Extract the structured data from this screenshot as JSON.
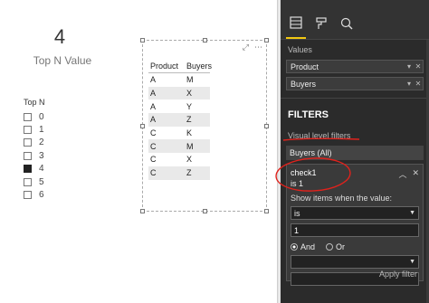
{
  "card": {
    "value": "4",
    "label": "Top N Value"
  },
  "slicer": {
    "title": "Top N",
    "items": [
      {
        "label": "0",
        "checked": false
      },
      {
        "label": "1",
        "checked": false
      },
      {
        "label": "2",
        "checked": false
      },
      {
        "label": "3",
        "checked": false
      },
      {
        "label": "4",
        "checked": true
      },
      {
        "label": "5",
        "checked": false
      },
      {
        "label": "6",
        "checked": false
      }
    ]
  },
  "table": {
    "columns": [
      "Product",
      "Buyers"
    ],
    "rows": [
      [
        "A",
        "M"
      ],
      [
        "A",
        "X"
      ],
      [
        "A",
        "Y"
      ],
      [
        "A",
        "Z"
      ],
      [
        "C",
        "K"
      ],
      [
        "C",
        "M"
      ],
      [
        "C",
        "X"
      ],
      [
        "C",
        "Z"
      ]
    ]
  },
  "pane": {
    "tabs": [
      "fields-tab",
      "format-tab",
      "analytics-tab"
    ],
    "values_label": "Values",
    "wells": [
      "Product",
      "Buyers"
    ],
    "filters_title": "FILTERS",
    "visual_level_label": "Visual level filters",
    "filter_chip": "Buyers  (All)",
    "filter_card": {
      "name": "check1",
      "condition": "is 1",
      "show_items_label": "Show items when the value:",
      "operator": "is",
      "value": "1",
      "and_label": "And",
      "or_label": "Or",
      "second_operator": ""
    },
    "apply_filter": "Apply filter"
  },
  "colors": {
    "accent": "#f2c811",
    "annotation": "#e0221c",
    "pane_bg": "#2b2b2b"
  }
}
